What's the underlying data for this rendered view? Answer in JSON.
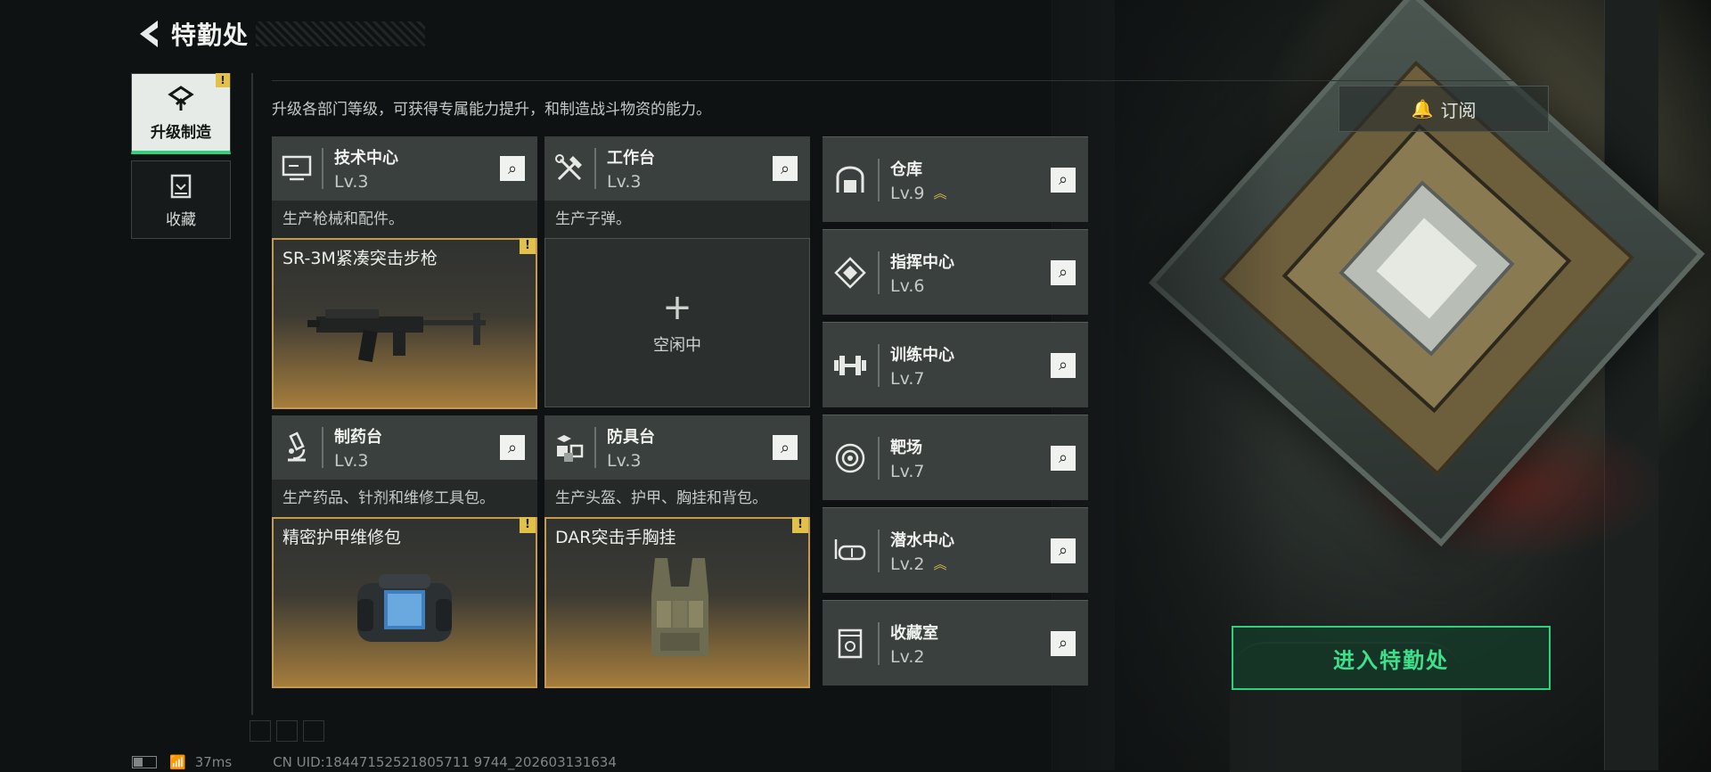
{
  "header": {
    "title": "特勤处"
  },
  "sidebar": {
    "tabs": [
      {
        "label": "升级制造",
        "active": true,
        "alert": "!"
      },
      {
        "label": "收藏",
        "active": false
      }
    ]
  },
  "intro": "升级各部门等级，可获得专属能力提升，和制造战斗物资的能力。",
  "subscribe": {
    "label": "订阅",
    "icon": "bell-icon"
  },
  "stations": [
    {
      "name": "技术中心",
      "level": "Lv.3",
      "icon": "monitor-icon",
      "desc": "生产枪械和配件。",
      "product": "SR-3M紧凑突击步枪",
      "alert": "!"
    },
    {
      "name": "工作台",
      "level": "Lv.3",
      "icon": "tools-icon",
      "desc": "生产子弹。",
      "idle_label": "空闲中",
      "plus": "+"
    },
    {
      "name": "制药台",
      "level": "Lv.3",
      "icon": "microscope-icon",
      "desc": "生产药品、针剂和维修工具包。",
      "product": "精密护甲维修包",
      "alert": "!"
    },
    {
      "name": "防具台",
      "level": "Lv.3",
      "icon": "boxes-icon",
      "desc": "生产头盔、护甲、胸挂和背包。",
      "product": "DAR突击手胸挂",
      "alert": "!"
    }
  ],
  "departments": [
    {
      "name": "仓库",
      "level": "Lv.9",
      "icon": "warehouse-icon",
      "upgradable": true
    },
    {
      "name": "指挥中心",
      "level": "Lv.6",
      "icon": "command-icon",
      "upgradable": false
    },
    {
      "name": "训练中心",
      "level": "Lv.7",
      "icon": "dumbbell-icon",
      "upgradable": false
    },
    {
      "name": "靶场",
      "level": "Lv.7",
      "icon": "target-icon",
      "upgradable": false
    },
    {
      "name": "潜水中心",
      "level": "Lv.2",
      "icon": "diving-mask-icon",
      "upgradable": true
    },
    {
      "name": "收藏室",
      "level": "Lv.2",
      "icon": "collection-icon",
      "upgradable": false
    }
  ],
  "enter_button": "进入特勤处",
  "footer": {
    "ping": "37ms",
    "uid": "CN UID:18447152521805711 9744_202603131634"
  },
  "colors": {
    "accent_green": "#2fd27a",
    "alert_yellow": "#e2c14a",
    "product_gold": "#c79a47"
  }
}
